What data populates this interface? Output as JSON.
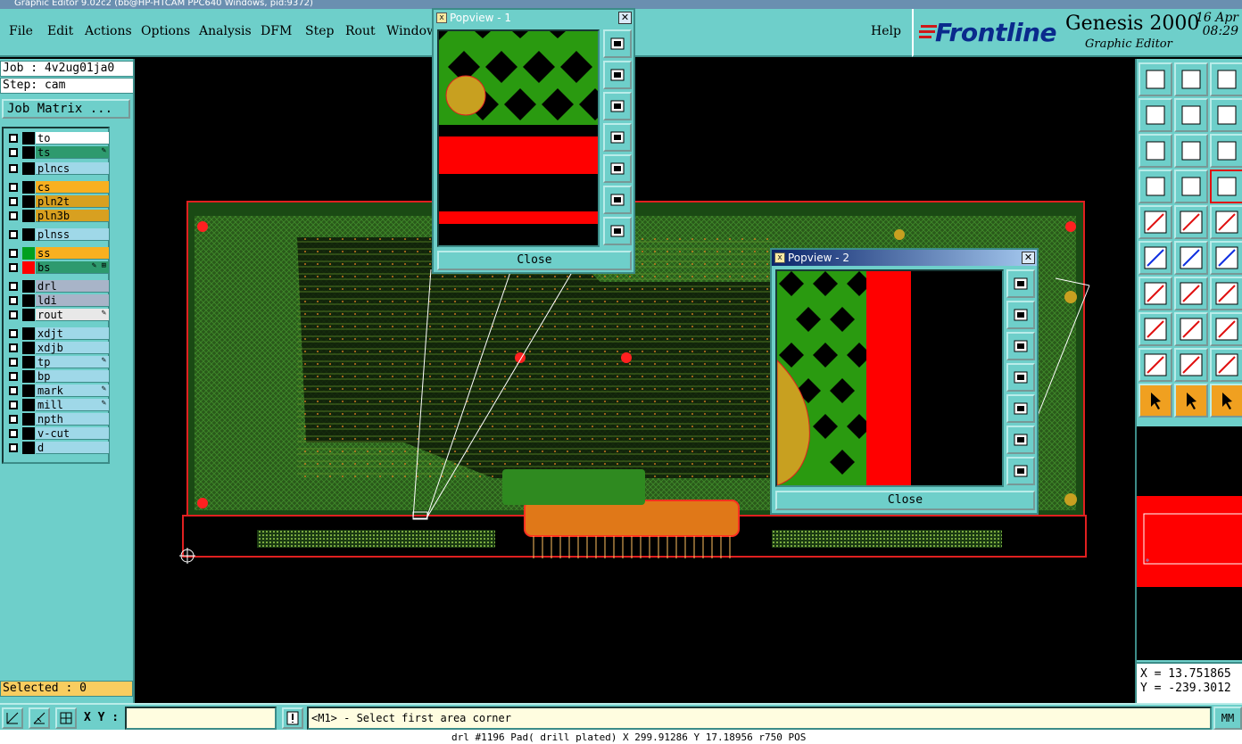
{
  "title_bar": "Graphic Editor 9.02c2 (bb@HP-HTCAM PPC640  Windows, pid:9372)",
  "menubar": {
    "items": [
      {
        "label": "File",
        "underline": "F"
      },
      {
        "label": "Edit",
        "underline": "E"
      },
      {
        "label": "Actions",
        "underline": "A"
      },
      {
        "label": "Options",
        "underline": "O"
      },
      {
        "label": "Analysis",
        "underline": "y"
      },
      {
        "label": "DFM",
        "underline": "D"
      },
      {
        "label": "Step",
        "underline": "S"
      },
      {
        "label": "Rout",
        "underline": "R"
      },
      {
        "label": "Window",
        "underline": "W"
      }
    ],
    "help": "Help"
  },
  "brand": {
    "logo": "Frontline",
    "product": "Genesis 2000",
    "subtitle": "Graphic Editor",
    "date": "16 Apr",
    "time": "08:29"
  },
  "job": {
    "job_label": "Job : 4v2ug01ja0",
    "step_label": "Step: cam",
    "matrix_button": "Job Matrix ..."
  },
  "layers": [
    {
      "name": "to",
      "name_bg": "#ffffff",
      "color": "#000000",
      "marker": ""
    },
    {
      "name": "ts",
      "name_bg": "#2e9a6e",
      "color": "#000000",
      "marker": "✎"
    },
    {
      "name": "plncs",
      "name_bg": "#9fd8e8",
      "color": "#000000",
      "marker": ""
    },
    {
      "name": "cs",
      "name_bg": "#f8b020",
      "color": "#000000",
      "marker": ""
    },
    {
      "name": "pln2t",
      "name_bg": "#d8a020",
      "color": "#000000",
      "marker": ""
    },
    {
      "name": "pln3b",
      "name_bg": "#d8a020",
      "color": "#000000",
      "marker": ""
    },
    {
      "name": "plnss",
      "name_bg": "#9fd8e8",
      "color": "#000000",
      "marker": ""
    },
    {
      "name": "ss",
      "name_bg": "#f8b020",
      "color": "#00a020",
      "marker": ""
    },
    {
      "name": "bs",
      "name_bg": "#2e9a6e",
      "color": "#ff0000",
      "marker": "✎ ⊞"
    },
    {
      "name": "drl",
      "name_bg": "#a8b4c8",
      "color": "#000000",
      "marker": ""
    },
    {
      "name": "ldi",
      "name_bg": "#a8b4c8",
      "color": "#000000",
      "marker": ""
    },
    {
      "name": "rout",
      "name_bg": "#e8e8e8",
      "color": "#000000",
      "marker": "✎"
    },
    {
      "name": "xdjt",
      "name_bg": "#9fd8e8",
      "color": "#000000",
      "marker": ""
    },
    {
      "name": "xdjb",
      "name_bg": "#9fd8e8",
      "color": "#000000",
      "marker": ""
    },
    {
      "name": "tp",
      "name_bg": "#9fd8e8",
      "color": "#000000",
      "marker": "✎"
    },
    {
      "name": "bp",
      "name_bg": "#9fd8e8",
      "color": "#000000",
      "marker": ""
    },
    {
      "name": "mark",
      "name_bg": "#9fd8e8",
      "color": "#000000",
      "marker": "✎"
    },
    {
      "name": "mill",
      "name_bg": "#9fd8e8",
      "color": "#000000",
      "marker": "✎"
    },
    {
      "name": "npth",
      "name_bg": "#9fd8e8",
      "color": "#000000",
      "marker": ""
    },
    {
      "name": "v-cut",
      "name_bg": "#9fd8e8",
      "color": "#000000",
      "marker": ""
    },
    {
      "name": "d",
      "name_bg": "#9fd8e8",
      "color": "#000000",
      "marker": ""
    }
  ],
  "selected": "Selected : 0",
  "coords": {
    "x": "X = 13.751865",
    "y": "Y = -239.3012"
  },
  "bottom": {
    "xy_label": "X Y :",
    "xy_value": "",
    "prompt": "<M1> - Select first area corner",
    "units": "MM"
  },
  "status_line": "drl #1196 Pad( drill plated) X 299.91286 Y 17.18956 r750 POS",
  "popview1": {
    "title": "Popview - 1",
    "close_label": "Close"
  },
  "popview2": {
    "title": "Popview - 2",
    "close_label": "Close"
  },
  "colors": {
    "panel": "#6ecfca",
    "board_green": "#2e7d1e",
    "copper_red": "#ff0000",
    "pad_orange": "#e0a020",
    "title_active": "#0a246a"
  }
}
